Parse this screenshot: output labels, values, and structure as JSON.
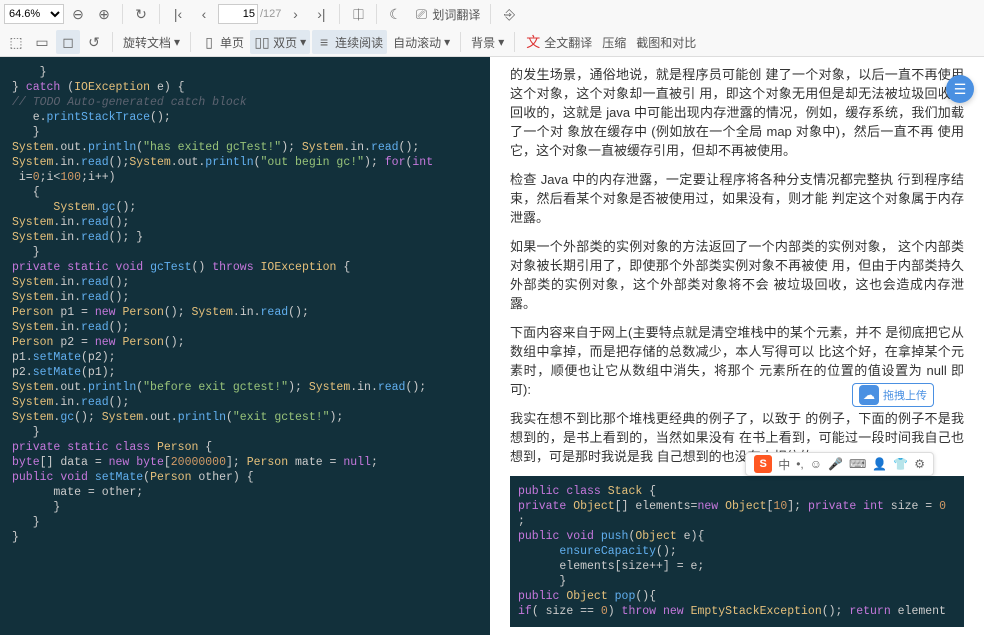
{
  "toolbar": {
    "zoom": "64.6%",
    "rotate_label": "旋转文档",
    "single_page": "单页",
    "double_page": "双页",
    "continuous": "连续阅读",
    "auto_scroll": "自动滚动",
    "background": "背景",
    "word_translate": "划词翻译",
    "full_translate": "全文翻译",
    "compress": "压缩",
    "screenshot_compare": "截图和对比",
    "page_current": "15",
    "page_total": "/127"
  },
  "code_left": {
    "l1": "    }",
    "l2": "} catch (IOException e) {",
    "l3": "// TODO Auto-generated catch block",
    "l4": "   e.printStackTrace();",
    "l5": "   }",
    "l6": "System.out.println(\"has exited gcTest!\"); System.in.read();",
    "l7": "System.in.read();System.out.println(\"out begin gc!\"); for(int",
    "l8": " i=0;i<100;i++)",
    "l9": "   {",
    "l10": "      System.gc();",
    "l11": "System.in.read();",
    "l12": "System.in.read(); }",
    "l13": "   }",
    "l14": "private static void gcTest() throws IOException {",
    "l15": "System.in.read();",
    "l16": "System.in.read();",
    "l17": "Person p1 = new Person(); System.in.read();",
    "l18": "System.in.read();",
    "l19": "Person p2 = new Person();",
    "l20": "p1.setMate(p2);",
    "l21": "p2.setMate(p1);",
    "l22": "System.out.println(\"before exit gctest!\"); System.in.read();",
    "l23": "System.in.read();",
    "l24": "System.gc(); System.out.println(\"exit gctest!\");",
    "l25": "   }",
    "l26": "private static class Person {",
    "l27": "byte[] data = new byte[20000000]; Person mate = null;",
    "l28": "public void setMate(Person other) {",
    "l29": "      mate = other;",
    "l30": "      }",
    "l31": "   }",
    "l32": "}"
  },
  "text_right": {
    "p1": "的发生场景，通俗地说，就是程序员可能创 建了一个对象，以后一直不再使用这个对象，这个对象却一直被引 用，即这个对象无用但是却无法被垃圾回收器回收的，这就是 java 中可能出现内存泄露的情况，例如，缓存系统，我们加载了一个对 象放在缓存中 (例如放在一个全局 map 对象中)，然后一直不再 使用它，这个对象一直被缓存引用，但却不再被使用。",
    "p2": "检查 Java 中的内存泄露，一定要让程序将各种分支情况都完整执 行到程序结束，然后看某个对象是否被使用过，如果没有，则才能 判定这个对象属于内存泄露。",
    "p3": "如果一个外部类的实例对象的方法返回了一个内部类的实例对象， 这个内部类对象被长期引用了，即使那个外部类实例对象不再被使 用，但由于内部类持久外部类的实例对象，这个外部类对象将不会 被垃圾回收，这也会造成内存泄露。",
    "p4": "下面内容来自于网上(主要特点就是清空堆栈中的某个元素，并不 是彻底把它从数组中拿掉，而是把存储的总数减少，本人写得可以 比这个好，在拿掉某个元素时，顺便也让它从数组中消失，将那个 元素所在的位置的值设置为 null 即可):",
    "p5": "我实在想不到比那个堆栈更经典的例子了，以致于                    的例子，下面的例子不是我想到的，是书上看到的，当然如果没有 在书上看到，可能过一段时间我自己也想到，可是那时我说是我 自己想到的也没有人相信的。"
  },
  "code_right": {
    "l1": "public class Stack {",
    "l2": "private Object[] elements=new Object[10]; private int size = 0;",
    "l3": "public void push(Object e){",
    "l4": "      ensureCapacity();",
    "l5": "      elements[size++] = e;",
    "l6": "      }",
    "l7": "public Object pop(){",
    "l8": "if( size == 0) throw new EmptyStackException(); return element"
  },
  "upload": {
    "label": "拖拽上传"
  },
  "ime": {
    "lang": "中"
  }
}
